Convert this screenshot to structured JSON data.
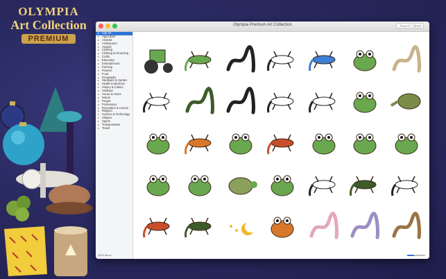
{
  "promo": {
    "brand": "OLYMPIA",
    "line2": "Art Collection",
    "badge": "PREMIUM"
  },
  "window": {
    "title": "Olympia Premium Art Collection",
    "search_placeholder": "Search Clipart",
    "search_label": "Search"
  },
  "sidebar": {
    "items": [
      {
        "label": "Clip Art",
        "selected": true
      },
      {
        "label": "Agriculture"
      },
      {
        "label": "Animals"
      },
      {
        "label": "Architecture"
      },
      {
        "label": "Awards"
      },
      {
        "label": "Clothing"
      },
      {
        "label": "Clothing & Grooming"
      },
      {
        "label": "Crafts"
      },
      {
        "label": "Education"
      },
      {
        "label": "Entertainment"
      },
      {
        "label": "Farming"
      },
      {
        "label": "Flowers"
      },
      {
        "label": "Food"
      },
      {
        "label": "Geography"
      },
      {
        "label": "Hardware & Garden"
      },
      {
        "label": "Health & Medicine"
      },
      {
        "label": "History & Culture"
      },
      {
        "label": "Holidays"
      },
      {
        "label": "House & Home"
      },
      {
        "label": "Nature"
      },
      {
        "label": "People"
      },
      {
        "label": "Professions"
      },
      {
        "label": "Recreation & Leisure"
      },
      {
        "label": "Religion"
      },
      {
        "label": "Science & Technology"
      },
      {
        "label": "Shapes"
      },
      {
        "label": "Sports"
      },
      {
        "label": "Transportation"
      },
      {
        "label": "Travel"
      }
    ],
    "footer": "1834 items"
  },
  "clipart": [
    "tractor",
    "lizard",
    "snake-coil",
    "salamander-outline",
    "gecko",
    "frog-blue",
    "snake-wavy",
    "chameleon-outline",
    "cobra",
    "snake-outline",
    "salamander-outline",
    "gecko-outline",
    "frog-toy",
    "tadpole",
    "frog-plush",
    "gecko-orange",
    "frog-cartoon",
    "chameleon",
    "frog-pond",
    "frog-green",
    "frog-sitting",
    "frog-branch",
    "frog-small",
    "turtle",
    "frog-sitting-green",
    "lizard-outline",
    "gecko-dark",
    "gecko-outline",
    "gecko-red",
    "lizard-black",
    "moon-stars",
    "toad",
    "worm",
    "snake-purple",
    "snake-branch"
  ],
  "colors": {
    "selection": "#2f73d9",
    "background": "#2a2a62"
  }
}
